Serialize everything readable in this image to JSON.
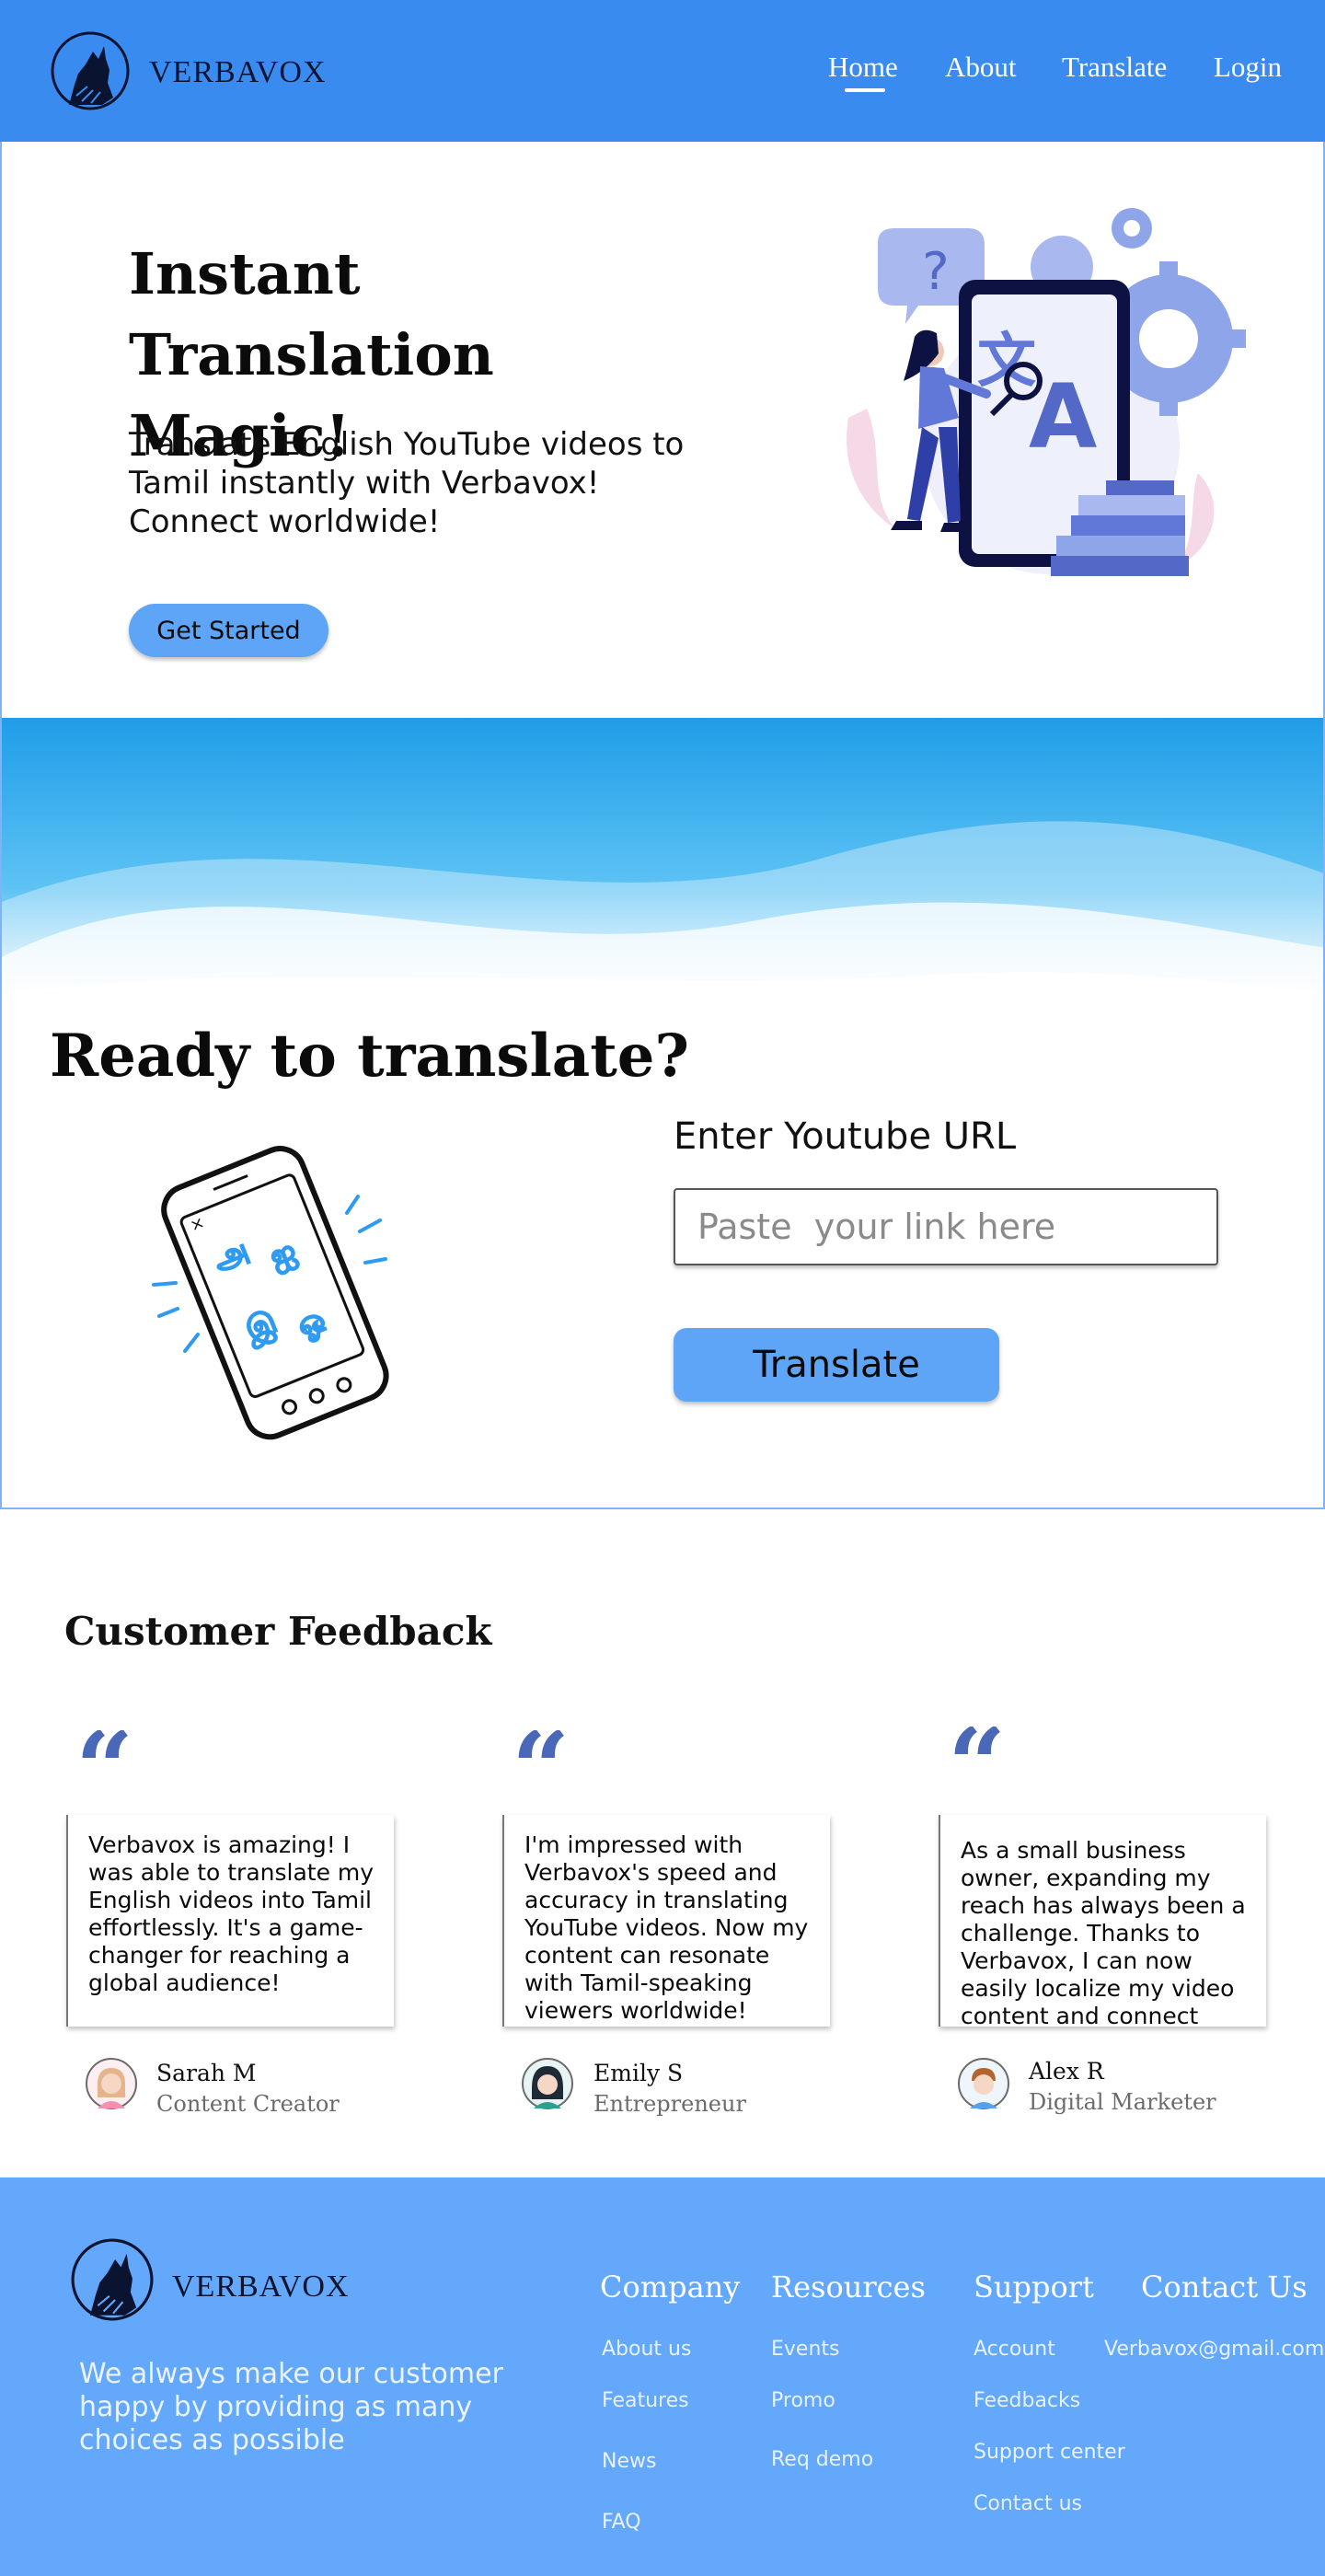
{
  "nav": {
    "brand": "VERBAVOX",
    "links": [
      "Home",
      "About",
      "Translate",
      "Login"
    ],
    "active": "Home",
    "logo_icon": "wolf-howl-icon"
  },
  "hero": {
    "title": "Instant Translation Magic!",
    "subtitle": "Translate English YouTube videos to Tamil instantly with Verbavox! Connect worldwide!",
    "cta_label": "Get Started",
    "illustration": "translation-illustration",
    "illustration_glyphs": {
      "question": "?",
      "kanji": "文",
      "latin": "A"
    }
  },
  "translate": {
    "heading": "Ready to translate?",
    "url_label": "Enter Youtube URL",
    "url_placeholder": "Paste  your link here",
    "button_label": "Translate",
    "phone_glyphs": [
      "அ",
      "ஐ",
      "இ",
      "ஓ"
    ],
    "phone_close": "×"
  },
  "feedback": {
    "heading": "Customer Feedback",
    "quote_mark": "“",
    "items": [
      {
        "text": "Verbavox is amazing! I was able to translate my English videos into Tamil effortlessly. It's a game-changer for reaching a global audience!",
        "name": "Sarah M",
        "role": "Content Creator"
      },
      {
        "text": "I'm impressed with Verbavox's speed and accuracy in translating YouTube videos. Now my content can resonate with Tamil-speaking viewers worldwide!",
        "name": "Emily S",
        "role": "Entrepreneur"
      },
      {
        "text": "As a small business owner, expanding my reach has always been a challenge. Thanks to Verbavox, I can now easily localize my video content and connect with new customers in",
        "name": "Alex R",
        "role": "Digital Marketer"
      }
    ]
  },
  "footer": {
    "brand": "VERBAVOX",
    "tagline": "We always make our customer happy by providing as many choices as possible",
    "columns": [
      {
        "title": "Company",
        "links": [
          "About us",
          "Features",
          "News",
          "FAQ"
        ]
      },
      {
        "title": "Resources",
        "links": [
          "Events",
          "Promo",
          "Req demo"
        ]
      },
      {
        "title": "Support",
        "links": [
          "Account",
          "Feedbacks",
          "Support center",
          "Contact us"
        ]
      },
      {
        "title": "Contact Us",
        "links": [
          "Verbavox@gmail.com"
        ]
      }
    ]
  },
  "colors": {
    "nav_bg": "#3a8bef",
    "accent": "#5ea4f7",
    "footer_bg": "#63a8fb",
    "quote": "#4a68b8"
  }
}
